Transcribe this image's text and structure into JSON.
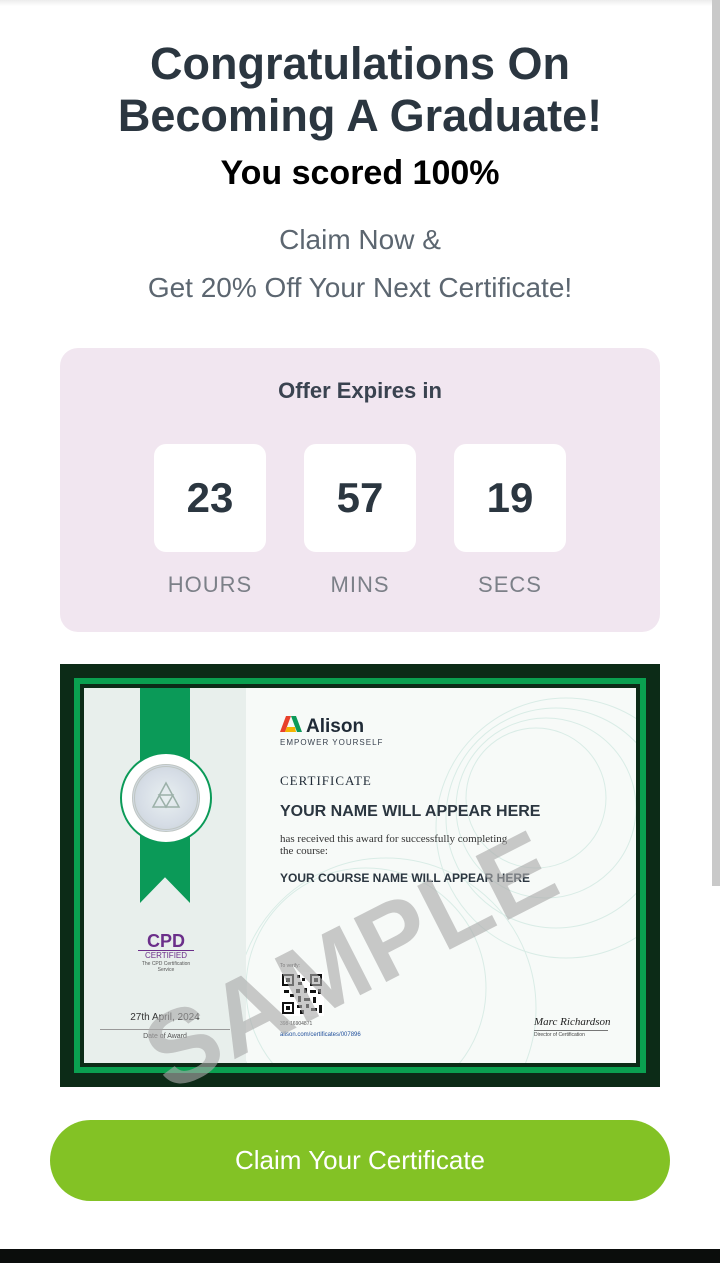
{
  "header": {
    "title_line1": "Congratulations On",
    "title_line2": "Becoming A Graduate!",
    "score": "You scored 100%",
    "claim_line1": "Claim Now &",
    "claim_line2": "Get 20% Off Your Next Certificate!"
  },
  "offer": {
    "title": "Offer Expires in",
    "hours": "23",
    "mins": "57",
    "secs": "19",
    "hours_label": "HOURS",
    "mins_label": "MINS",
    "secs_label": "SECS"
  },
  "certificate": {
    "brand": "Alison",
    "tagline": "EMPOWER YOURSELF",
    "heading": "CERTIFICATE",
    "name_placeholder": "YOUR NAME WILL APPEAR HERE",
    "received_text": "has received this award for successfully completing the course:",
    "course_placeholder": "YOUR COURSE NAME WILL APPEAR HERE",
    "watermark": "SAMPLE",
    "award_date": "27th April, 2024",
    "award_label": "Date of Award",
    "cpd_main": "CPD",
    "cpd_sub": "CERTIFIED",
    "cpd_small": "The CPD Certification Service",
    "verify_label": "To verify:",
    "verify_id": "398-16904871",
    "verify_url": "alison.com/certificates/007896",
    "signature": "Marc Richardson",
    "signature_title": "Director of Certification"
  },
  "cta": {
    "label": "Claim Your Certificate"
  },
  "colors": {
    "cta_green": "#83c225",
    "offer_bg": "#f1e6f0",
    "ribbon_green": "#0b9a58",
    "frame_dark": "#0c2b17"
  }
}
